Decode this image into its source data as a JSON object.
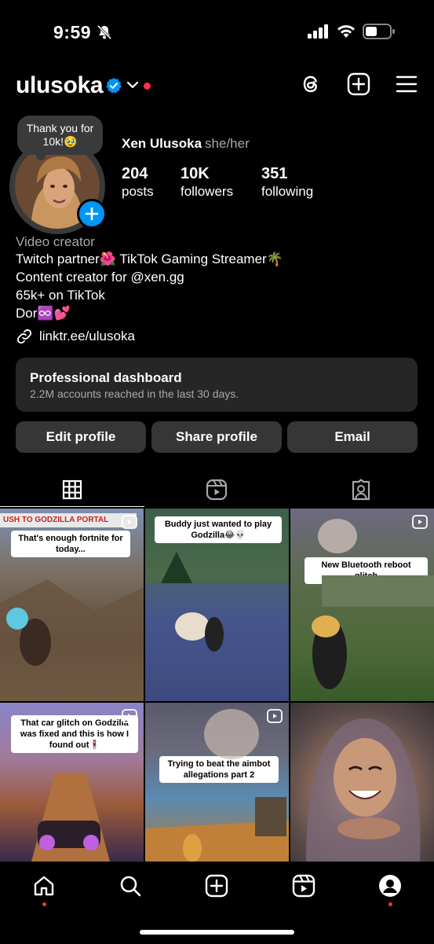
{
  "status_bar": {
    "time": "9:59"
  },
  "header": {
    "username": "ulusoka"
  },
  "profile": {
    "note": "Thank you for 10k!🥹",
    "full_name": "Xen Ulusoka",
    "pronouns": "she/her",
    "stats": [
      {
        "value": "204",
        "label": "posts"
      },
      {
        "value": "10K",
        "label": "followers"
      },
      {
        "value": "351",
        "label": "following"
      }
    ]
  },
  "bio": {
    "category": "Video creator",
    "lines": [
      "Twitch partner🌺 TikTok Gaming Streamer🌴",
      "Content creator for @xen.gg",
      "65k+ on TikTok",
      "Dor♾️💕"
    ],
    "link": "linktr.ee/ulusoka"
  },
  "dashboard": {
    "title": "Professional dashboard",
    "subtitle": "2.2M accounts reached in the last 30 days."
  },
  "buttons": {
    "edit": "Edit profile",
    "share": "Share profile",
    "email": "Email"
  },
  "grid": [
    {
      "caption": "That's enough fortnite for today...",
      "banner": "USH TO GODZILLA PORTAL",
      "colors": [
        "#7d8fb3",
        "#5a4a3a",
        "#8a6a4a"
      ]
    },
    {
      "caption": "Buddy just wanted to play Godzilla😂💀",
      "colors": [
        "#3d5f4a",
        "#3f4f7a",
        "#2e3a5e"
      ]
    },
    {
      "caption": "New Bluetooth reboot glitch",
      "colors": [
        "#6e6a80",
        "#4e6a3a",
        "#3a5a2a"
      ]
    },
    {
      "caption": "That car glitch on Godzilla was fixed and this is how I found out🧍‍♀️",
      "colors": [
        "#8a84c8",
        "#9a5a3a",
        "#3a2a4a"
      ]
    },
    {
      "caption": "Trying to beat the aimbot allegations part 2",
      "colors": [
        "#5a5a6a",
        "#5a8ab0",
        "#b07a3a"
      ]
    },
    {
      "caption": "",
      "colors": [
        "#6a5a5a",
        "#8a6a5a",
        "#c8a080"
      ]
    }
  ]
}
